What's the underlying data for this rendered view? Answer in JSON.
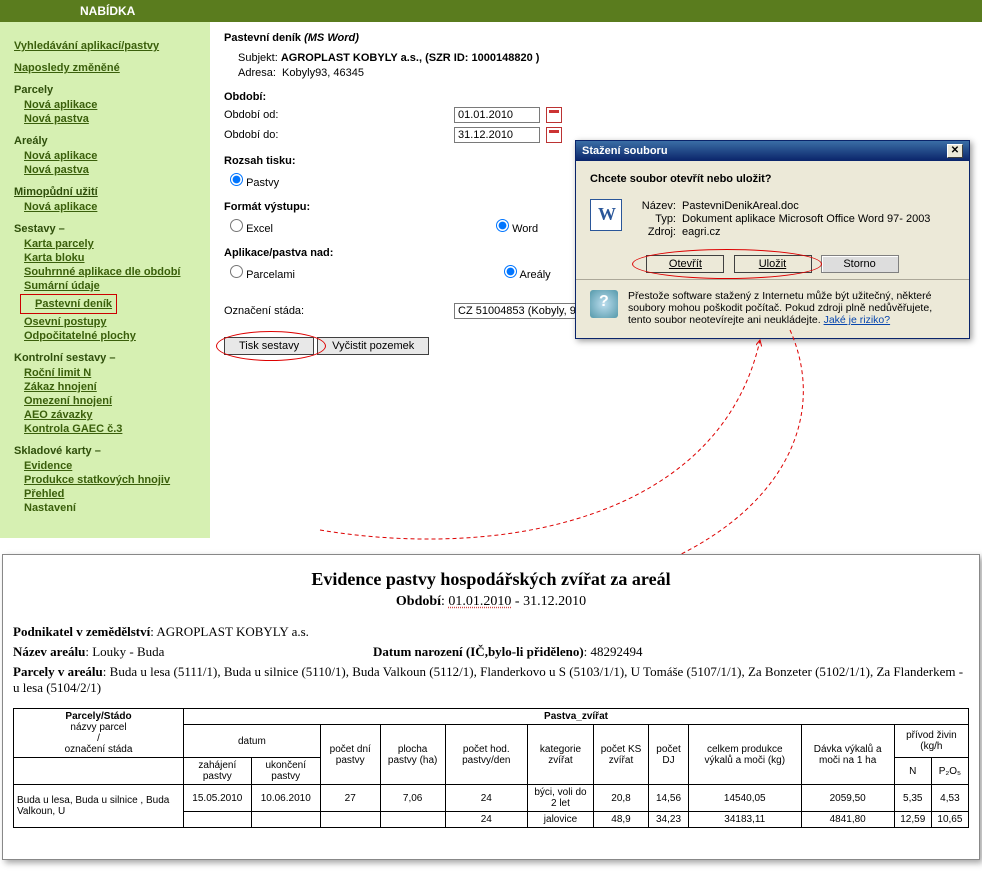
{
  "topbar": {
    "title": "NABÍDKA"
  },
  "sidebar": {
    "g1": {
      "search": "Vyhledávání aplikací/pastvy",
      "recent": "Naposledy změněné"
    },
    "g2": {
      "head": "Parcely",
      "a": "Nová aplikace",
      "b": "Nová pastva"
    },
    "g3": {
      "head": "Areály",
      "a": "Nová aplikace",
      "b": "Nová pastva"
    },
    "g4": {
      "head": "Mimopůdní užití",
      "a": "Nová aplikace"
    },
    "g5": {
      "head": "Sestavy –",
      "a": "Karta parcely",
      "b": "Karta bloku",
      "c": "Souhrnné aplikace dle období",
      "d": "Sumární údaje",
      "e": "Pastevní deník",
      "f": "Osevní postupy",
      "g": "Odpočitatelné plochy"
    },
    "g6": {
      "head": "Kontrolní sestavy –",
      "a": "Roční limit N",
      "b": "Zákaz hnojení",
      "c": "Omezení hnojení",
      "d": "AEO závazky",
      "e": "Kontrola GAEC č.3"
    },
    "g7": {
      "head": "Skladové karty –",
      "a": "Evidence",
      "b": "Produkce statkových hnojiv",
      "c": "Přehled",
      "d": "Nastavení"
    }
  },
  "main": {
    "title_a": "Pastevní deník ",
    "title_b": "(MS Word)",
    "subj_lbl": "Subjekt:",
    "subj": "AGROPLAST KOBYLY a.s., (SZR ID: 1000148820 )",
    "addr_lbl": "Adresa:",
    "addr": "Kobyly93, 46345",
    "sec_period": "Období:",
    "from_lbl": "Období od:",
    "from_val": "01.01.2010",
    "to_lbl": "Období do:",
    "to_val": "31.12.2010",
    "sec_scope": "Rozsah tisku:",
    "opt_pastvy": "Pastvy",
    "sec_fmt": "Formát výstupu:",
    "opt_excel": "Excel",
    "opt_word": "Word",
    "sec_over": "Aplikace/pastva nad:",
    "opt_parc": "Parcelami",
    "opt_areal": "Areály",
    "stado_lbl": "Označení stáda:",
    "stado_val": "CZ 51004853 (Kobyly, 93)",
    "btn_print": "Tisk sestavy",
    "btn_clear": "Vyčistit pozemek"
  },
  "dialog": {
    "title": "Stažení souboru",
    "q": "Chcete soubor otevřít nebo uložit?",
    "k_name": "Název:",
    "v_name": "PastevniDenikAreal.doc",
    "k_type": "Typ:",
    "v_type": "Dokument aplikace Microsoft Office Word 97- 2003",
    "k_src": "Zdroj:",
    "v_src": "eagri.cz",
    "b_open": "Otevřít",
    "b_save": "Uložit",
    "b_cancel": "Storno",
    "warn": "Přestože software stažený z Internetu může být užitečný, některé soubory mohou poškodit počítač. Pokud zdroji plně nedůvěřujete, tento soubor neotevírejte ani neukládejte. ",
    "warn_link": "Jaké je riziko?"
  },
  "doc": {
    "h": "Evidence pastvy hospodářských zvířat za areál",
    "period_lbl": "Období",
    "period_a": "01.01.2010",
    "period_sep": " - ",
    "period_b": "31.12.2010",
    "l1a": "Podnikatel v zemědělství",
    "l1b": ": AGROPLAST KOBYLY a.s.",
    "l2a": "Název areálu",
    "l2b": ": Louky - Buda",
    "l2c": "Datum narození (IČ,bylo-li přiděleno)",
    "l2d": ": 48292494",
    "l3a": "Parcely v areálu",
    "l3b": ": Buda u lesa (5111/1), Buda u silnice (5110/1), Buda Valkoun (5112/1), Flanderkovo u S (5103/1/1), U Tomáše (5107/1/1), Za Bonzeter (5102/1/1), Za Flanderkem - u lesa (5104/2/1)",
    "th_ps": "Parcely/Stádo",
    "th_names": "názvy parcel",
    "th_slash": "/",
    "th_ozn": "označení stáda",
    "th_pz": "Pastva_zvířat",
    "th_dat": "datum",
    "th_zah": "zahájení pastvy",
    "th_uk": "ukončení pastvy",
    "th_dni": "počet dní pastvy",
    "th_plocha": "plocha pastvy (ha)",
    "th_hod": "počet hod. pastvy/den",
    "th_kat": "kategorie zvířat",
    "th_ks": "počet KS zvířat",
    "th_dj": "počet DJ",
    "th_celk": "celkem produkce výkalů a moči (kg)",
    "th_davka": "Dávka výkalů a moči na 1 ha",
    "th_priv": "přívod živin (kg/h",
    "th_n": "N",
    "th_p": "P₂O₅",
    "r1": {
      "c1": "",
      "c2": "15.05.2010",
      "c3": "10.06.2010",
      "c4": "27",
      "c5": "7,06",
      "c6": "24",
      "c7": "býci, voli do 2 let",
      "c8": "20,8",
      "c9": "14,56",
      "c10": "14540,05",
      "c11": "2059,50",
      "c12": "5,35",
      "c13": "4,53"
    },
    "r2": {
      "c1": "Buda u lesa, Buda u silnice , Buda Valkoun, U",
      "c7": "jalovice",
      "c8": "48,9",
      "c9": "34,23",
      "c10": "34183,11",
      "c11": "4841,80",
      "c12": "12,59",
      "c13": "10,65"
    }
  }
}
